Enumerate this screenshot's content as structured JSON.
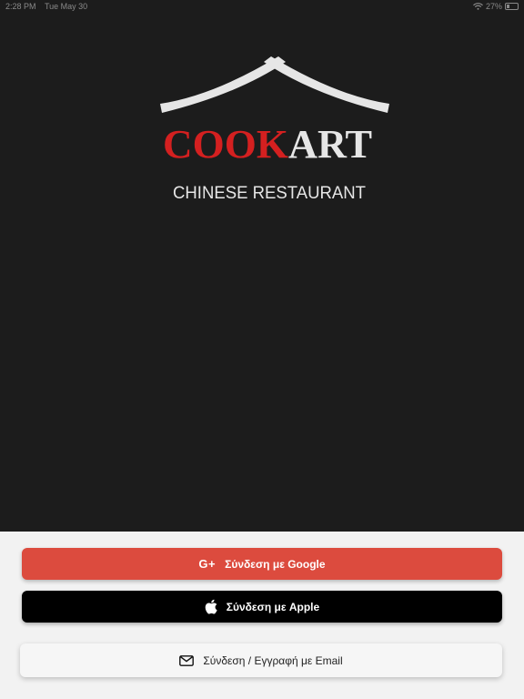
{
  "status_bar": {
    "time": "2:28 PM",
    "date": "Tue May 30",
    "battery": "27%",
    "battery_level": 0.27
  },
  "logo": {
    "brand_red": "COOK",
    "brand_white": "ART",
    "tagline": "CHINESE RESTAURANT",
    "colors": {
      "red": "#d42020",
      "white": "#e6e6e6"
    }
  },
  "login": {
    "google_icon": "G+",
    "google_label": "Σύνδεση με Google",
    "apple_label": "Σύνδεση με Apple",
    "email_label": "Σύνδεση / Εγγραφή με Email"
  },
  "colors": {
    "background": "#1c1c1c",
    "panel": "#f2f2f2",
    "google": "#dc4b3e",
    "apple": "#000000"
  }
}
